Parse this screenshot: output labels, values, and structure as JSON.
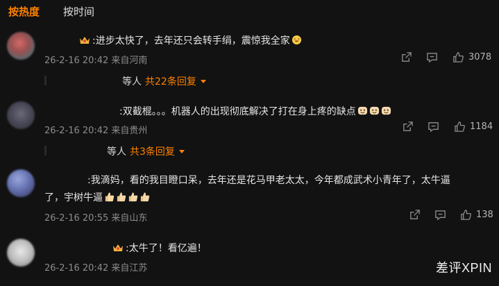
{
  "tabs": [
    {
      "label": "按热度",
      "active": true
    },
    {
      "label": "按时间",
      "active": false
    }
  ],
  "comments": [
    {
      "text": ":进步太快了，去年还只会转手绢，震惊我全家",
      "time": "26-2-16 20:42",
      "location": "来自河南",
      "likes": "3078",
      "reply_prefix": "等人",
      "reply_count": "共22条回复"
    },
    {
      "text": ":双截棍。。。机器人的出现彻底解决了打在身上疼的缺点",
      "time": "26-2-16 20:42",
      "location": "来自贵州",
      "likes": "1184",
      "reply_prefix": "等人",
      "reply_count": "共3条回复"
    },
    {
      "text_line1": ":我滴妈，看的我目瞪口呆，去年还是花马甲老太太，今年都成武术小青年了，太牛逼",
      "text_line2": "了，宇树牛逼",
      "time": "26-2-16 20:55",
      "location": "来自山东",
      "likes": "138"
    },
    {
      "text": ":太牛了！看亿遍！",
      "time": "26-2-16 20:42",
      "location": "来自江苏"
    }
  ],
  "watermark": "差评XPIN",
  "colors": {
    "background": "#121212",
    "accent": "#ff8200",
    "meta": "#8d8d8d"
  },
  "icons": [
    "crown-icon",
    "share-icon",
    "comment-icon",
    "like-icon",
    "laughing-emoji-icon",
    "thumbs-up-emoji-icon"
  ]
}
